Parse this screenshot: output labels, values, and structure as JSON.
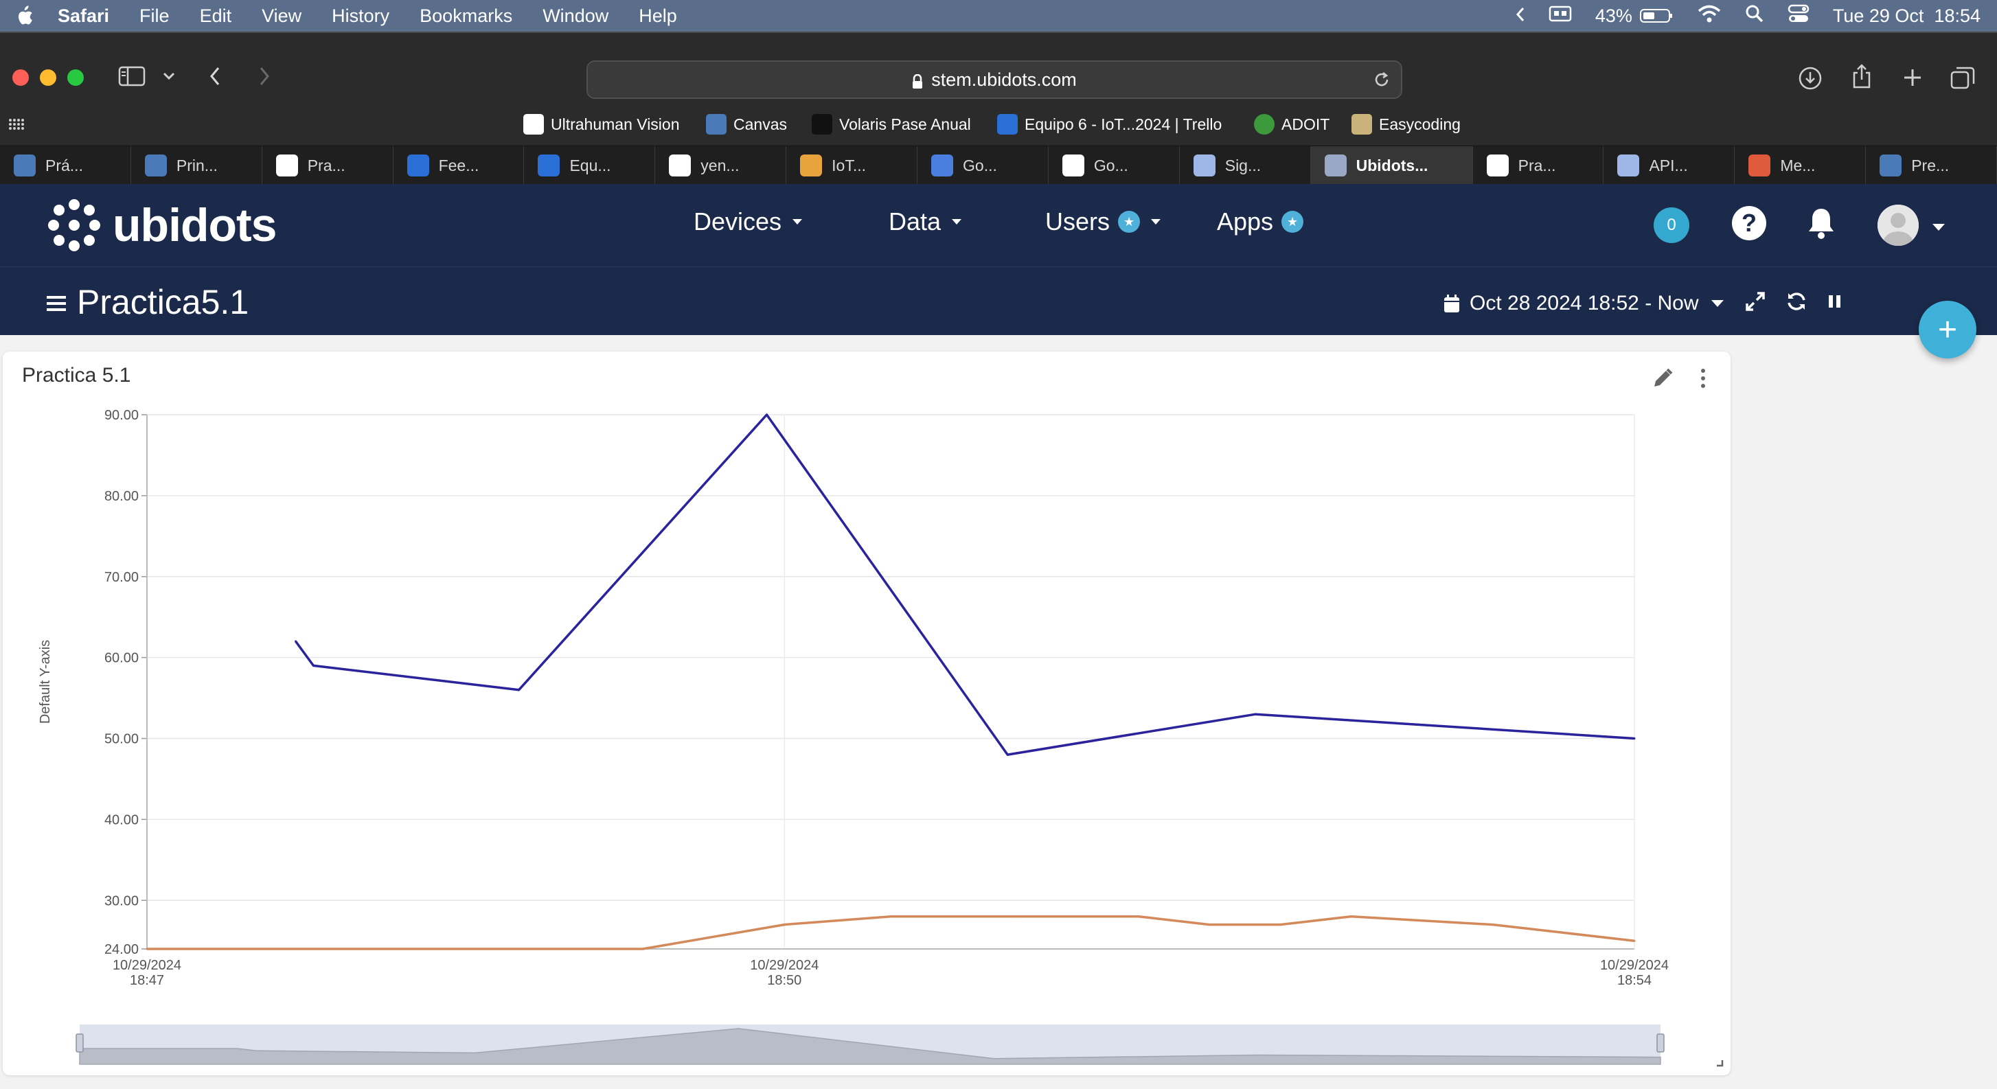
{
  "menubar": {
    "items": [
      "Safari",
      "File",
      "Edit",
      "View",
      "History",
      "Bookmarks",
      "Window",
      "Help"
    ],
    "battery": "43%",
    "datetime": "Tue 29 Oct  18:54"
  },
  "browser": {
    "url": "stem.ubidots.com",
    "favorites": [
      {
        "label": "Ultrahuman Vision",
        "icon": "ultrahuman-icon",
        "color": "#ffffff"
      },
      {
        "label": "Canvas",
        "icon": "canvas-icon",
        "color": "#4a7ab8"
      },
      {
        "label": "Volaris Pase Anual",
        "icon": "volaris-icon",
        "color": "#111111"
      },
      {
        "label": "Equipo 6 - IoT...2024 | Trello",
        "icon": "trello-icon",
        "color": "#2a6fd6"
      },
      {
        "label": "ADOIT",
        "icon": "adoit-icon",
        "color": "#3c9a3c"
      },
      {
        "label": "Easycoding",
        "icon": "easycoding-icon",
        "color": "#c9b37a"
      }
    ],
    "tabs": [
      {
        "label": "Prá...",
        "icon": "canvas-icon",
        "color": "#4a7ab8"
      },
      {
        "label": "Prin...",
        "icon": "canvas-icon",
        "color": "#4a7ab8"
      },
      {
        "label": "Pra...",
        "icon": "github-icon",
        "color": "#ffffff"
      },
      {
        "label": "Fee...",
        "icon": "linkedin-icon",
        "color": "#2a6fd6"
      },
      {
        "label": "Equ...",
        "icon": "trello-icon",
        "color": "#2a6fd6"
      },
      {
        "label": "yen...",
        "icon": "google-icon",
        "color": "#ffffff"
      },
      {
        "label": "IoT...",
        "icon": "gcloud-icon",
        "color": "#e8a33c"
      },
      {
        "label": "Go...",
        "icon": "translate-icon",
        "color": "#4a7fe0"
      },
      {
        "label": "Go...",
        "icon": "medium-icon",
        "color": "#ffffff"
      },
      {
        "label": "Sig...",
        "icon": "chat-icon",
        "color": "#9fb7e6"
      },
      {
        "label": "Ubidots...",
        "icon": "ubidots-icon",
        "color": "#9aa7c7",
        "active": true
      },
      {
        "label": "Pra...",
        "icon": "github-icon",
        "color": "#ffffff"
      },
      {
        "label": "API...",
        "icon": "chat-icon",
        "color": "#9fb7e6"
      },
      {
        "label": "Me...",
        "icon": "meet-icon",
        "color": "#e05a3c"
      },
      {
        "label": "Pre...",
        "icon": "canvas-icon",
        "color": "#4a7ab8"
      }
    ]
  },
  "ubidots": {
    "logo_text": "ubidots",
    "nav": {
      "devices": "Devices",
      "data": "Data",
      "users": "Users",
      "apps": "Apps"
    },
    "star_glyph": "★",
    "notifications_count": "0",
    "help_glyph": "?",
    "dashboard_title": "Practica5.1",
    "date_range": "Oct 28 2024 18:52 - Now",
    "add_glyph": "+"
  },
  "widget": {
    "title": "Practica 5.1"
  },
  "chart_data": {
    "type": "line",
    "title": "Practica 5.1",
    "ylabel": "Default Y-axis",
    "ylim": [
      24,
      90
    ],
    "yticks": [
      24,
      30,
      40,
      50,
      60,
      70,
      80,
      90
    ],
    "ytick_labels": [
      "24.00",
      "30.00",
      "40.00",
      "50.00",
      "60.00",
      "70.00",
      "80.00",
      "90.00"
    ],
    "xlim": [
      "10/29/2024 18:47",
      "10/29/2024 18:54"
    ],
    "xticks": [
      {
        "date": "10/29/2024",
        "time": "18:47",
        "value": "18:47:00"
      },
      {
        "date": "10/29/2024",
        "time": "18:50",
        "value": "18:50:00"
      },
      {
        "date": "10/29/2024",
        "time": "18:54",
        "value": "18:54:00"
      }
    ],
    "grid": true,
    "series": [
      {
        "color": "#2a239c",
        "points": [
          {
            "x": "18:47:42",
            "y": 62
          },
          {
            "x": "18:47:47",
            "y": 59
          },
          {
            "x": "18:48:45",
            "y": 56
          },
          {
            "x": "18:49:55",
            "y": 90
          },
          {
            "x": "18:51:03",
            "y": 48
          },
          {
            "x": "18:52:13",
            "y": 53
          },
          {
            "x": "18:54:00",
            "y": 50
          }
        ]
      },
      {
        "color": "#d4895a",
        "points": [
          {
            "x": "18:47:00",
            "y": 24
          },
          {
            "x": "18:48:30",
            "y": 24
          },
          {
            "x": "18:49:20",
            "y": 24
          },
          {
            "x": "18:50:00",
            "y": 27
          },
          {
            "x": "18:50:30",
            "y": 28
          },
          {
            "x": "18:51:05",
            "y": 28
          },
          {
            "x": "18:51:40",
            "y": 28
          },
          {
            "x": "18:52:00",
            "y": 27
          },
          {
            "x": "18:52:20",
            "y": 27
          },
          {
            "x": "18:52:40",
            "y": 28
          },
          {
            "x": "18:53:20",
            "y": 27
          },
          {
            "x": "18:53:40",
            "y": 26
          },
          {
            "x": "18:54:00",
            "y": 25
          }
        ]
      }
    ]
  }
}
